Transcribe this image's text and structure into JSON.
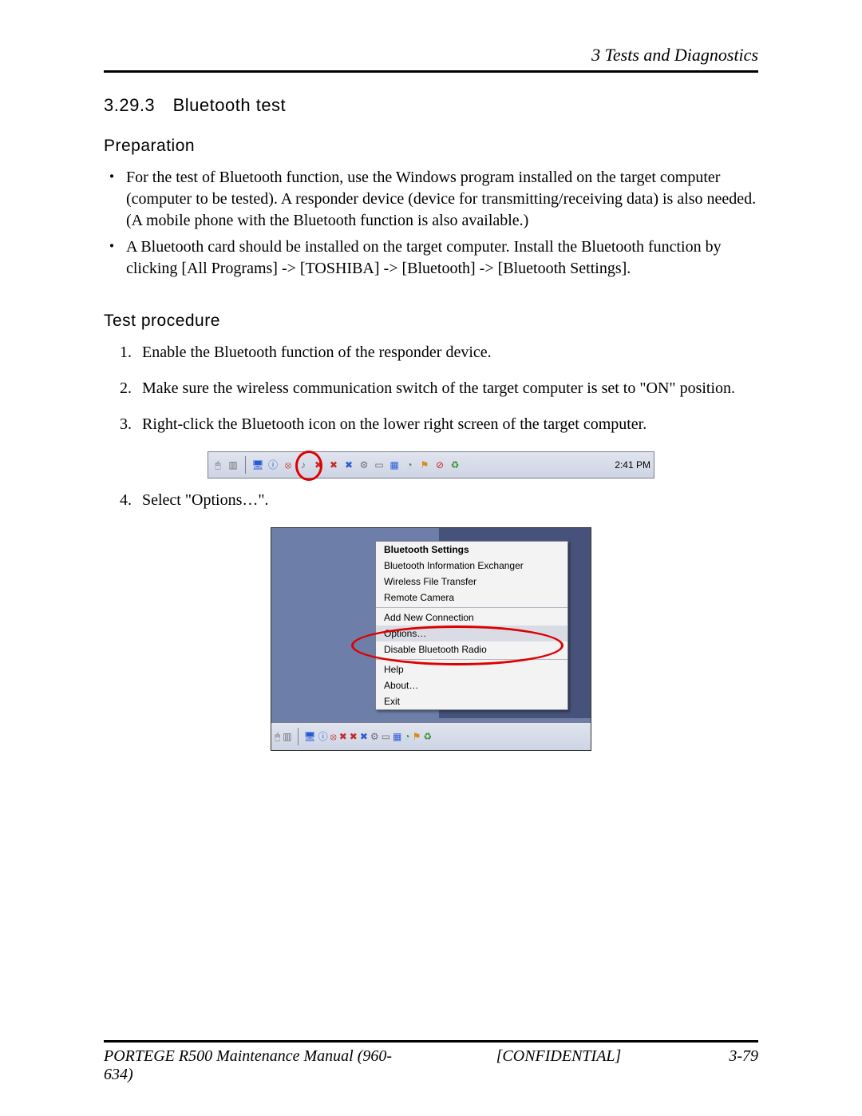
{
  "header": {
    "running_title": "3  Tests and Diagnostics"
  },
  "section": {
    "number": "3.29.3",
    "title": "Bluetooth test"
  },
  "prep": {
    "heading": "Preparation",
    "items": [
      "For the test of Bluetooth function, use the Windows program installed on the target computer (computer to be tested). A responder device (device for transmitting/receiving data) is also needed. (A mobile phone with the Bluetooth function is also available.)",
      "A Bluetooth card should be installed on the target computer.  Install the Bluetooth function by clicking [All Programs] -> [TOSHIBA] -> [Bluetooth] -> [Bluetooth Settings]."
    ]
  },
  "proc": {
    "heading": "Test procedure",
    "steps": [
      "Enable the Bluetooth function of the responder device.",
      "Make sure the wireless communication switch of the target computer is set to \"ON\" position.",
      "Right-click the Bluetooth icon on the lower right screen of the target computer.",
      "Select \"Options…\"."
    ]
  },
  "tray": {
    "clock": "2:41 PM",
    "icons": [
      {
        "name": "mouse-icon",
        "glyph": "🖱",
        "color": "grey"
      },
      {
        "name": "program-icon",
        "glyph": "▥",
        "color": "grey"
      },
      {
        "name": "separator",
        "glyph": "",
        "color": ""
      },
      {
        "name": "desktop-icon",
        "glyph": "🖥",
        "color": "blue"
      },
      {
        "name": "bluetooth-icon",
        "glyph": "ⓘ",
        "color": "blue"
      },
      {
        "name": "alert-icon",
        "glyph": "⦻",
        "color": "red"
      },
      {
        "name": "speaker-icon",
        "glyph": "♪",
        "color": "grey"
      },
      {
        "name": "volume-red-icon",
        "glyph": "✖",
        "color": "red"
      },
      {
        "name": "volume-red2-icon",
        "glyph": "✖",
        "color": "red"
      },
      {
        "name": "volume-blue-icon",
        "glyph": "✖",
        "color": "blue"
      },
      {
        "name": "util-icon",
        "glyph": "⚙",
        "color": "grey"
      },
      {
        "name": "monitor-icon",
        "glyph": "▭",
        "color": "grey"
      },
      {
        "name": "window-icon",
        "glyph": "▦",
        "color": "blue"
      },
      {
        "name": "globe-icon",
        "glyph": "◔",
        "color": "green"
      },
      {
        "name": "flag-icon",
        "glyph": "⚑",
        "color": "orange"
      },
      {
        "name": "stop-icon",
        "glyph": "⊘",
        "color": "red"
      },
      {
        "name": "recycle-icon",
        "glyph": "♻",
        "color": "green"
      }
    ]
  },
  "context_menu": {
    "items": [
      {
        "label": "Bluetooth Settings",
        "bold": true
      },
      {
        "label": "Bluetooth Information Exchanger"
      },
      {
        "label": "Wireless File Transfer"
      },
      {
        "label": "Remote Camera"
      },
      {
        "hr": true
      },
      {
        "label": "Add New Connection"
      },
      {
        "label": "Options…",
        "highlight": true
      },
      {
        "label": "Disable Bluetooth Radio"
      },
      {
        "hr": true
      },
      {
        "label": "Help"
      },
      {
        "label": "About…"
      },
      {
        "label": "Exit"
      }
    ]
  },
  "footer": {
    "left": "PORTEGE R500 Maintenance Manual (960-634)",
    "mid": "[CONFIDENTIAL]",
    "right": "3-79"
  }
}
